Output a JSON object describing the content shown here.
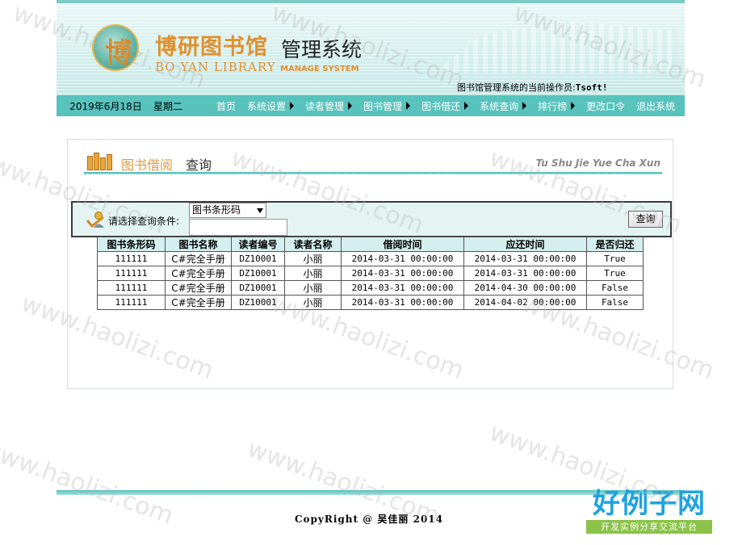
{
  "header": {
    "logo_glyph": "博",
    "title_cn": "博研图书馆",
    "title_cn_2": "管理系统",
    "title_en": "BO YAN LIBRARY",
    "title_en_2": "MANAGE SYSTEM",
    "operator_label": "图书馆管理系统的当前操作员:",
    "operator_name": "Tsoft!"
  },
  "nav": {
    "date": "2019年6月18日",
    "weekday": "星期二",
    "items": [
      {
        "label": "首页",
        "has_arrow": false
      },
      {
        "label": "系统设置",
        "has_arrow": true
      },
      {
        "label": "读者管理",
        "has_arrow": true
      },
      {
        "label": "图书管理",
        "has_arrow": true
      },
      {
        "label": "图书借还",
        "has_arrow": true
      },
      {
        "label": "系统查询",
        "has_arrow": true
      },
      {
        "label": "排行榜",
        "has_arrow": true
      },
      {
        "label": "更改口令",
        "has_arrow": false
      },
      {
        "label": "退出系统",
        "has_arrow": false
      }
    ]
  },
  "section": {
    "title_highlight": "图书借阅",
    "title_rest": "查询",
    "title_en": "Tu Shu Jie Yue Cha Xun"
  },
  "query": {
    "label": "请选择查询条件:",
    "select_value": "图书条形码",
    "input_value": "",
    "button_label": "查询"
  },
  "table": {
    "columns": [
      "图书条形码",
      "图书名称",
      "读者编号",
      "读者名称",
      "借阅时间",
      "应还时间",
      "是否归还"
    ],
    "rows": [
      [
        "111111",
        "C#完全手册",
        "DZ10001",
        "小丽",
        "2014-03-31 00:00:00",
        "2014-03-31 00:00:00",
        "True"
      ],
      [
        "111111",
        "C#完全手册",
        "DZ10001",
        "小丽",
        "2014-03-31 00:00:00",
        "2014-03-31 00:00:00",
        "True"
      ],
      [
        "111111",
        "C#完全手册",
        "DZ10001",
        "小丽",
        "2014-03-31 00:00:00",
        "2014-04-30 00:00:00",
        "False"
      ],
      [
        "111111",
        "C#完全手册",
        "DZ10001",
        "小丽",
        "2014-03-31 00:00:00",
        "2014-04-02 00:00:00",
        "False"
      ]
    ]
  },
  "footer": {
    "copyright": "CopyRight @ 吴佳丽 2014"
  },
  "brand": {
    "name": "好例子网",
    "tagline": "开发实例分享交流平台"
  },
  "watermark": {
    "text": "www.haolizi.com"
  },
  "colors": {
    "accent": "#58c2bd",
    "title_orange": "#e0902f",
    "header_bg": "#d4efed"
  }
}
